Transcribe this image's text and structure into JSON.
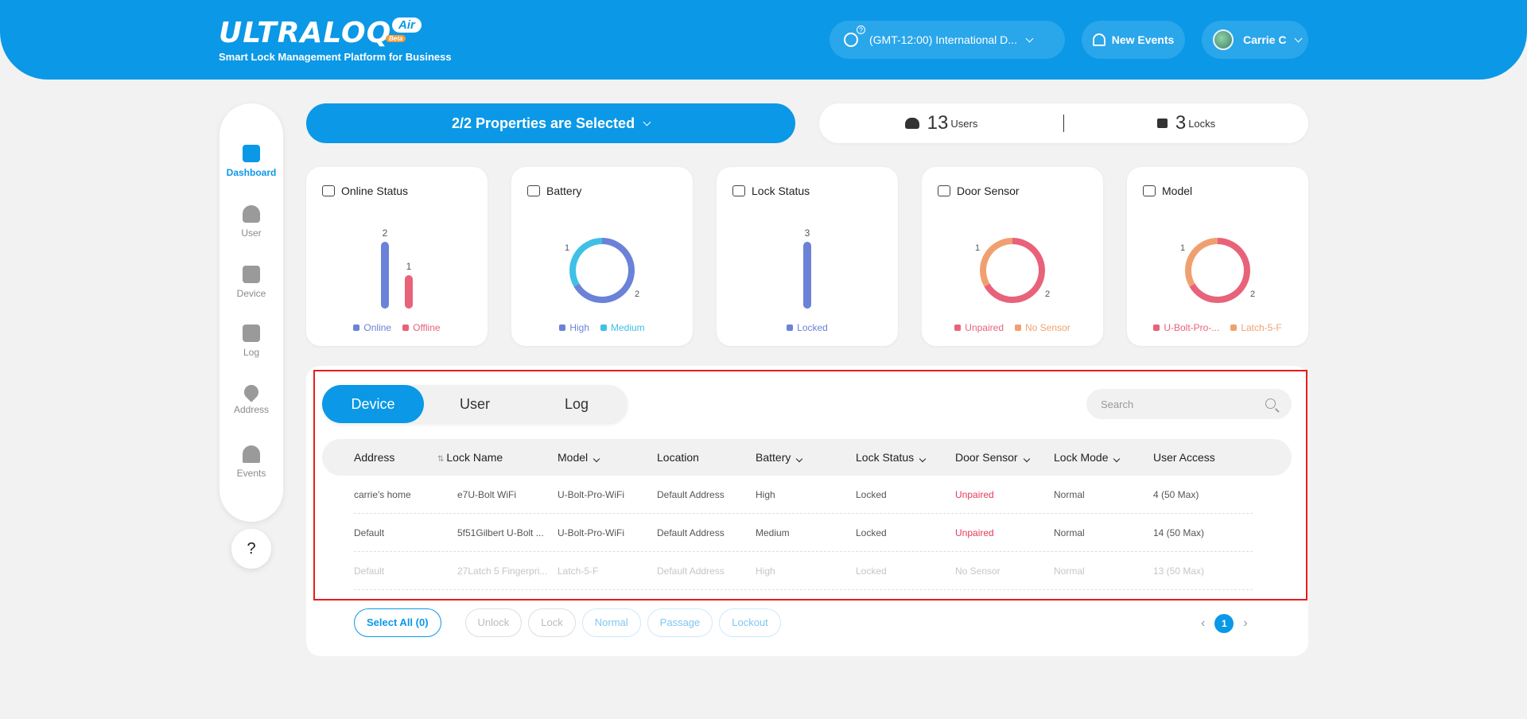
{
  "header": {
    "logo_text": "ULTRALOQ",
    "logo_badge": "Air",
    "logo_beta": "Beta",
    "subtitle": "Smart Lock Management Platform for Business",
    "timezone": "(GMT-12:00) International D...",
    "events_label": "New Events",
    "user_name": "Carrie C"
  },
  "sidebar": {
    "items": [
      {
        "label": "Dashboard",
        "icon": "dashboard-icon",
        "active": true
      },
      {
        "label": "User",
        "icon": "user-icon"
      },
      {
        "label": "Device",
        "icon": "device-icon"
      },
      {
        "label": "Log",
        "icon": "log-icon"
      },
      {
        "label": "Address",
        "icon": "location-pin-icon"
      },
      {
        "label": "Events",
        "icon": "alarm-icon"
      }
    ],
    "help": "?"
  },
  "top": {
    "property_selector": "2/2 Properties are Selected",
    "users_count": "13",
    "users_label": "Users",
    "locks_count": "3",
    "locks_label": "Locks"
  },
  "colors": {
    "brand": "#0b98e6",
    "blue_series": "#6b82d8",
    "cyan_series": "#3fc0e6",
    "pink_series": "#e8627a",
    "orange_series": "#f0a070",
    "alert_red": "#e8395a"
  },
  "cards": [
    {
      "title": "Online Status",
      "icon": "signal-icon",
      "legend": [
        "Online",
        "Offline"
      ]
    },
    {
      "title": "Battery",
      "icon": "battery-icon",
      "legend": [
        "High",
        "Medium"
      ]
    },
    {
      "title": "Lock Status",
      "icon": "lock-icon",
      "legend": [
        "Locked"
      ]
    },
    {
      "title": "Door Sensor",
      "icon": "door-icon",
      "legend": [
        "Unpaired",
        "No Sensor"
      ]
    },
    {
      "title": "Model",
      "icon": "device-model-icon",
      "legend": [
        "U-Bolt-Pro-...",
        "Latch-5-F"
      ]
    }
  ],
  "chart_data": [
    {
      "type": "bar",
      "title": "Online Status",
      "categories": [
        "Online",
        "Offline"
      ],
      "values": [
        2,
        1
      ],
      "ylim": [
        0,
        2
      ]
    },
    {
      "type": "pie",
      "title": "Battery",
      "categories": [
        "High",
        "Medium"
      ],
      "values": [
        2,
        1
      ]
    },
    {
      "type": "bar",
      "title": "Lock Status",
      "categories": [
        "Locked"
      ],
      "values": [
        3
      ],
      "ylim": [
        0,
        3
      ]
    },
    {
      "type": "pie",
      "title": "Door Sensor",
      "categories": [
        "Unpaired",
        "No Sensor"
      ],
      "values": [
        2,
        1
      ]
    },
    {
      "type": "pie",
      "title": "Model",
      "categories": [
        "U-Bolt-Pro-...",
        "Latch-5-F"
      ],
      "values": [
        2,
        1
      ]
    }
  ],
  "tabs": [
    "Device",
    "User",
    "Log"
  ],
  "search": {
    "placeholder": "Search"
  },
  "table": {
    "columns": [
      "Address",
      "Lock Name",
      "Model",
      "Location",
      "Battery",
      "Lock Status",
      "Door Sensor",
      "Lock Mode",
      "User Access"
    ],
    "rows": [
      [
        "carrie's home",
        "e7U-Bolt WiFi",
        "U-Bolt-Pro-WiFi",
        "Default Address",
        "High",
        "Locked",
        "Unpaired",
        "Normal",
        "4 (50 Max)"
      ],
      [
        "Default",
        "5f51Gilbert U-Bolt ...",
        "U-Bolt-Pro-WiFi",
        "Default Address",
        "Medium",
        "Locked",
        "Unpaired",
        "Normal",
        "14 (50 Max)"
      ],
      [
        "Default",
        "27Latch 5 Fingerpri...",
        "Latch-5-F",
        "Default Address",
        "High",
        "Locked",
        "No Sensor",
        "Normal",
        "13 (50 Max)"
      ]
    ]
  },
  "actions": {
    "select_all": "Select All (0)",
    "unlock": "Unlock",
    "lock": "Lock",
    "normal": "Normal",
    "passage": "Passage",
    "lockout": "Lockout"
  },
  "pagination": {
    "current": "1",
    "prev": "‹",
    "next": "›"
  }
}
